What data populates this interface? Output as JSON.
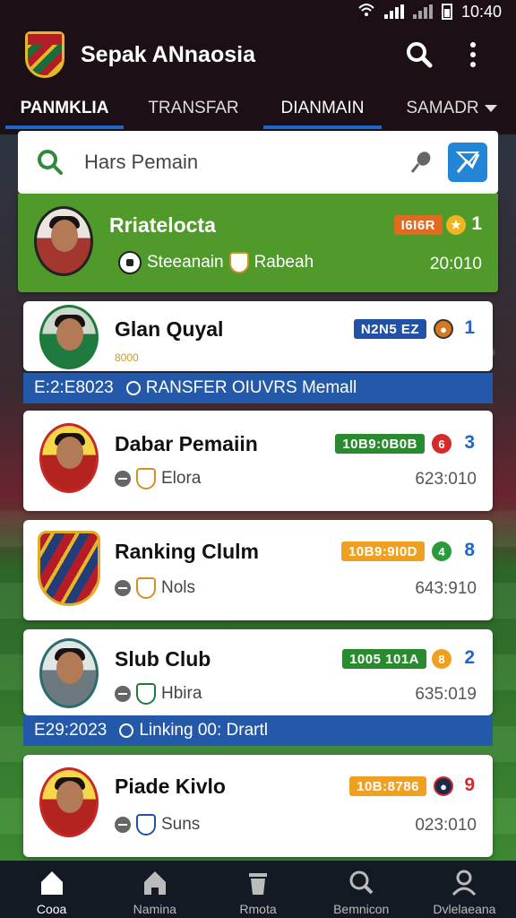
{
  "status_bar": {
    "time": "10:40"
  },
  "app": {
    "title": "Sepak ANnaosia"
  },
  "tabs": [
    {
      "label": "PANMKLIA"
    },
    {
      "label": "TRANSFAR"
    },
    {
      "label": "DIANMAIN"
    },
    {
      "label": "SAMADR"
    }
  ],
  "search": {
    "placeholder": "Hars Pemain"
  },
  "cards": [
    {
      "name": "Rriatelocta",
      "badge": "I6I6R",
      "rank": "1",
      "sub": "Steeanain",
      "sub2": "Rabeah",
      "time": "20:010"
    },
    {
      "name": "Glan Quyal",
      "badge": "N2N5 EZ",
      "rank": "1",
      "tagline": "8000"
    },
    {
      "name": "Dabar Pemaiin",
      "badge": "10B9:0B0B",
      "rank": "3",
      "sub": "Elora",
      "time": "623:010"
    },
    {
      "name": "Ranking Clulm",
      "badge": "10B9:9I0D",
      "rank": "8",
      "sub": "Nols",
      "time": "643:910"
    },
    {
      "name": "Slub Club",
      "badge": "1005 101A",
      "rank": "2",
      "sub": "Hbira",
      "time": "635:019"
    },
    {
      "name": "Piade Kivlo",
      "badge": "10B:8786",
      "rank": "9",
      "sub": "Suns",
      "time": "023:010"
    }
  ],
  "stripes": [
    {
      "date": "E:2:E8023",
      "text": "RANSFER OIUVRS Memall"
    },
    {
      "date": "E29:2023",
      "text": "Linking 00: Drartl"
    }
  ],
  "bottom_nav": [
    {
      "label": "Cooa"
    },
    {
      "label": "Namina"
    },
    {
      "label": "Rmota"
    },
    {
      "label": "Bemnicon"
    },
    {
      "label": "Dvlelaeana"
    }
  ],
  "colors": {
    "accent": "#1e66c8",
    "highlight_card": "#4f9a2a",
    "stripe": "#2458a8"
  }
}
